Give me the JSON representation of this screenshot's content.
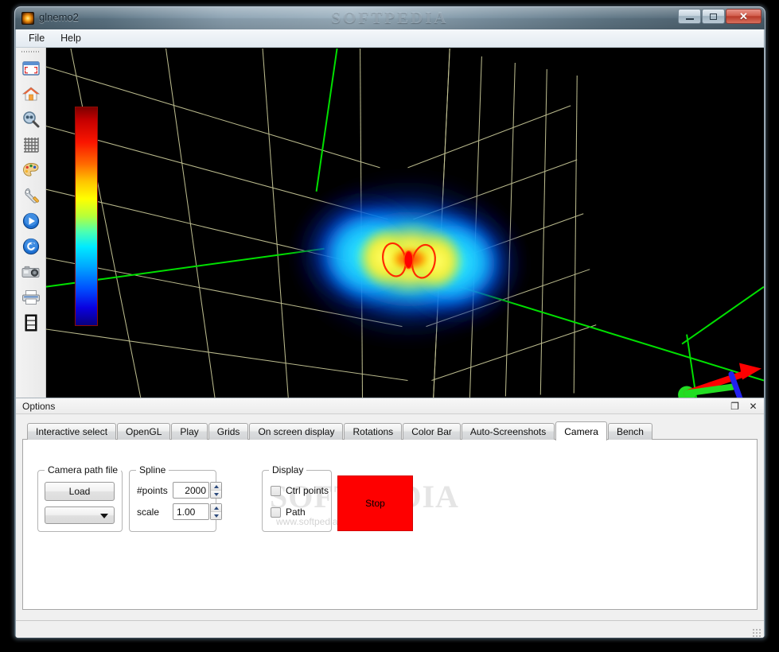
{
  "window": {
    "title": "glnemo2",
    "watermark": "SOFTPEDIA",
    "icon": "app-sun-icon",
    "minimize_label": "Minimize",
    "maximize_label": "Maximize",
    "close_label": "✕"
  },
  "menubar": {
    "items": [
      {
        "label": "File"
      },
      {
        "label": "Help"
      }
    ]
  },
  "toolbar": {
    "items": [
      {
        "icon": "fit-to-screen-icon",
        "tooltip": "Fit all to screen"
      },
      {
        "icon": "home-icon",
        "tooltip": "Reset to home view"
      },
      {
        "icon": "zoom-icon",
        "tooltip": "Zoom"
      },
      {
        "icon": "grid-icon",
        "tooltip": "Toggle grid"
      },
      {
        "icon": "palette-icon",
        "tooltip": "Color map"
      },
      {
        "icon": "wrench-icon",
        "tooltip": "Options"
      },
      {
        "icon": "play-icon",
        "tooltip": "Play animation"
      },
      {
        "icon": "reload-icon",
        "tooltip": "Reload"
      },
      {
        "icon": "camera-icon",
        "tooltip": "Screenshot"
      },
      {
        "icon": "printer-icon",
        "tooltip": "Print"
      },
      {
        "icon": "film-icon",
        "tooltip": "Movie"
      }
    ]
  },
  "glview": {
    "background_color": "#000000",
    "grid_color": "#c8c89a",
    "axis_x_color": "#ff0000",
    "axis_y_color": "#00ee00",
    "axis_z_color": "#2020ff",
    "colorbar": {
      "name": "density-colorbar",
      "stops": [
        "#7d0000",
        "#fa1500",
        "#ff6a00",
        "#ffff00",
        "#4dffb0",
        "#00eaff",
        "#0051ff",
        "#09007e"
      ]
    },
    "particle_cloud": {
      "name": "nbody-particle-cloud",
      "core_color": "#ff2200",
      "mid_color": "#ffe000",
      "halo_color": "#00d8ff",
      "outer_color": "#0a2fff"
    }
  },
  "options_dock": {
    "title": "Options",
    "float_icon": "❐",
    "close_icon": "✕",
    "tabs": [
      {
        "label": "Interactive select",
        "active": false
      },
      {
        "label": "OpenGL",
        "active": false
      },
      {
        "label": "Play",
        "active": false
      },
      {
        "label": "Grids",
        "active": false
      },
      {
        "label": "On screen display",
        "active": false
      },
      {
        "label": "Rotations",
        "active": false
      },
      {
        "label": "Color Bar",
        "active": false
      },
      {
        "label": "Auto-Screenshots",
        "active": false
      },
      {
        "label": "Camera",
        "active": true
      },
      {
        "label": "Bench",
        "active": false
      }
    ]
  },
  "camera_tab": {
    "camera_path_file": {
      "title": "Camera path file",
      "load_label": "Load",
      "combo_value": "",
      "combo_placeholder": ""
    },
    "spline": {
      "title": "Spline",
      "points_label": "#points",
      "points_value": "2000",
      "scale_label": "scale",
      "scale_value": "1.00"
    },
    "display": {
      "title": "Display",
      "ctrl_points_label": "Ctrl points",
      "ctrl_points_checked": false,
      "path_label": "Path",
      "path_checked": false
    },
    "stop_button": {
      "label": "Stop",
      "color": "#fe0000"
    }
  },
  "panel_watermark": {
    "text": "SOFTPEDIA",
    "sub": "www.softpedia.com"
  },
  "statusbar": {
    "text": ""
  }
}
